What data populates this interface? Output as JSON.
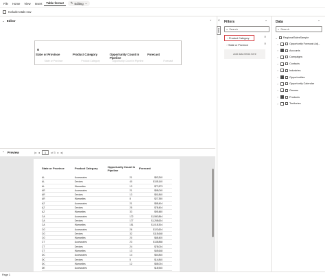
{
  "ribbon": {
    "tabs": [
      "File",
      "Home",
      "View",
      "Insert",
      "Table format"
    ],
    "active_tab": "Table format",
    "editing_label": "Editing",
    "include_totals": "Include totals row"
  },
  "editor": {
    "title": "Editor",
    "columns": [
      "State or Province",
      "Product Category",
      "Opportunity Count In Pipeline",
      "Forecast"
    ],
    "placeholders": [
      "State or Province",
      "Product Category",
      "Opportunity Count In Pipeline",
      "Forecast"
    ]
  },
  "preview": {
    "title": "Preview",
    "page": "1",
    "page_total": "of 3",
    "columns": [
      "State or Province",
      "Product Category",
      "Opportunity Count In Pipeline",
      "Forecast"
    ],
    "rows": [
      [
        "AL",
        "Accessories",
        "21",
        "$53,240"
      ],
      [
        "AL",
        "Devices",
        "40",
        "$135,140"
      ],
      [
        "AL",
        "Warranties",
        "13",
        "$77,673"
      ],
      [
        "AR",
        "Accessories",
        "21",
        "$58,040"
      ],
      [
        "AR",
        "Devices",
        "13",
        "$51,840"
      ],
      [
        "AR",
        "Warranties",
        "8",
        "$27,350"
      ],
      [
        "AZ",
        "Accessories",
        "21",
        "$58,404"
      ],
      [
        "AZ",
        "Devices",
        "25",
        "$78,404"
      ],
      [
        "AZ",
        "Warranties",
        "33",
        "$95,480"
      ],
      [
        "CA",
        "Accessories",
        "172",
        "$1,580,864"
      ],
      [
        "CA",
        "Devices",
        "177",
        "$1,258,634"
      ],
      [
        "CA",
        "Warranties",
        "151",
        "$1,018,304"
      ],
      [
        "CO",
        "Accessories",
        "26",
        "$120,604"
      ],
      [
        "CO",
        "Devices",
        "32",
        "$115,648"
      ],
      [
        "CO",
        "Warranties",
        "20",
        "$68,400"
      ],
      [
        "CT",
        "Accessories",
        "23",
        "$138,858"
      ],
      [
        "CT",
        "Devices",
        "24",
        "$78,004"
      ],
      [
        "CT",
        "Warranties",
        "13",
        "$45,648"
      ],
      [
        "DC",
        "Accessories",
        "14",
        "$54,840"
      ],
      [
        "DC",
        "Devices",
        "5",
        "$14,840"
      ],
      [
        "DC",
        "Warranties",
        "12",
        "$58,004"
      ],
      [
        "DE",
        "Accessories",
        "",
        "$18,940"
      ]
    ]
  },
  "filters": {
    "title": "Filters",
    "search_placeholder": "Search",
    "cards": [
      "Product Category",
      "State or Province"
    ],
    "drop_zone": "Add data fields here",
    "build_tab": "Build"
  },
  "data": {
    "title": "Data",
    "search_placeholder": "Search",
    "model": "RegionalSalesSample",
    "items": [
      {
        "label": "Opportunity Forecast Adj...",
        "checked": false
      },
      {
        "label": "Accounts",
        "checked": true
      },
      {
        "label": "Campaigns",
        "checked": false
      },
      {
        "label": "Contacts",
        "checked": false
      },
      {
        "label": "Industries",
        "checked": false
      },
      {
        "label": "Opportunities",
        "checked": true
      },
      {
        "label": "Opportunity Calendar",
        "checked": false
      },
      {
        "label": "Owners",
        "checked": false
      },
      {
        "label": "Products",
        "checked": true
      },
      {
        "label": "Territories",
        "checked": false
      }
    ]
  },
  "status": {
    "page": "Page 1"
  },
  "colors": {
    "accent": "#d13438",
    "grey": "#e6e6e6"
  }
}
